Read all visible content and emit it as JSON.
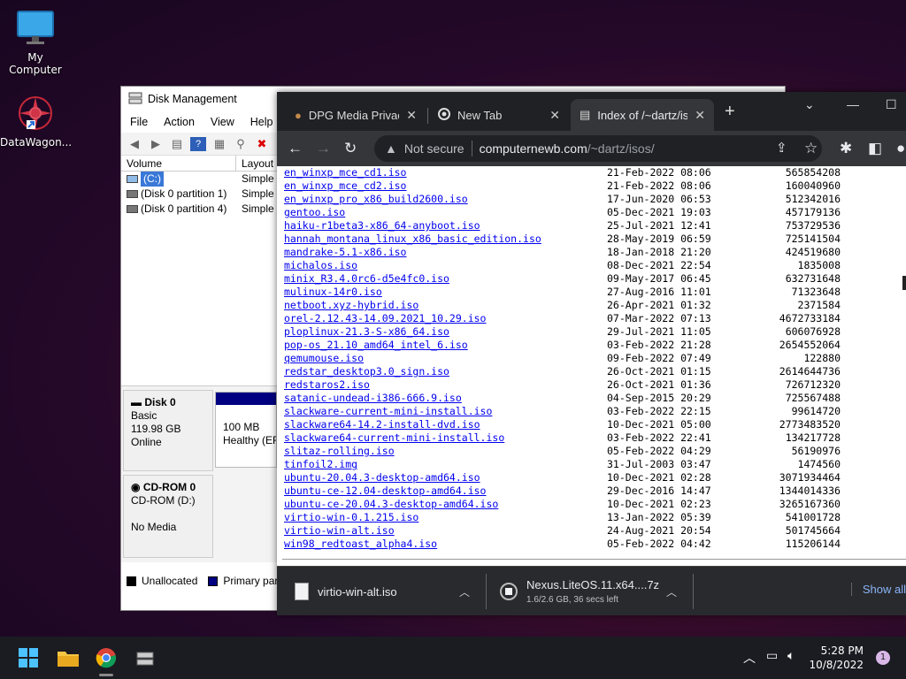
{
  "desktop": {
    "icons": [
      {
        "label": "My Computer"
      },
      {
        "label": "DataWagon..."
      }
    ]
  },
  "disk_management": {
    "title": "Disk Management",
    "menu": [
      "File",
      "Action",
      "View",
      "Help"
    ],
    "columns": [
      "Volume",
      "Layout"
    ],
    "volumes": [
      {
        "name": "(C:)",
        "layout": "Simple"
      },
      {
        "name": "(Disk 0 partition 1)",
        "layout": "Simple"
      },
      {
        "name": "(Disk 0 partition 4)",
        "layout": "Simple"
      }
    ],
    "disk0": {
      "name": "Disk 0",
      "type": "Basic",
      "size": "119.98 GB",
      "status": "Online"
    },
    "partition": {
      "size": "100 MB",
      "status": "Healthy (EF"
    },
    "cdrom": {
      "name": "CD-ROM 0",
      "type": "CD-ROM (D:)",
      "status": "No Media"
    },
    "legend": [
      {
        "label": "Unallocated",
        "color": "#000000"
      },
      {
        "label": "Primary parti",
        "color": "#000080"
      }
    ]
  },
  "browser": {
    "tabs": [
      {
        "title": "DPG Media Privacy"
      },
      {
        "title": "New Tab"
      },
      {
        "title": "Index of /~dartz/is"
      }
    ],
    "address": {
      "security": "Not secure",
      "host": "computernewb.com",
      "path": "/~dartz/isos/"
    },
    "files": [
      {
        "name": "en_winxp_mce_cd1.iso",
        "date": "21-Feb-2022 08:06",
        "size": "565854208"
      },
      {
        "name": "en_winxp_mce_cd2.iso",
        "date": "21-Feb-2022 08:06",
        "size": "160040960"
      },
      {
        "name": "en_winxp_pro_x86_build2600.iso",
        "date": "17-Jun-2020 06:53",
        "size": "512342016"
      },
      {
        "name": "gentoo.iso",
        "date": "05-Dec-2021 19:03",
        "size": "457179136"
      },
      {
        "name": "haiku-r1beta3-x86_64-anyboot.iso",
        "date": "25-Jul-2021 12:41",
        "size": "753729536"
      },
      {
        "name": "hannah_montana_linux_x86_basic_edition.iso",
        "date": "28-May-2019 06:59",
        "size": "725141504"
      },
      {
        "name": "mandrake-5.1-x86.iso",
        "date": "18-Jan-2018 21:20",
        "size": "424519680"
      },
      {
        "name": "michalos.iso",
        "date": "08-Dec-2021 22:54",
        "size": "1835008"
      },
      {
        "name": "minix_R3.4.0rc6-d5e4fc0.iso",
        "date": "09-May-2017 06:45",
        "size": "632731648"
      },
      {
        "name": "mulinux-14r0.iso",
        "date": "27-Aug-2016 11:01",
        "size": "71323648"
      },
      {
        "name": "netboot.xyz-hybrid.iso",
        "date": "26-Apr-2021 01:32",
        "size": "2371584"
      },
      {
        "name": "orel-2.12.43-14.09.2021_10.29.iso",
        "date": "07-Mar-2022 07:13",
        "size": "4672733184"
      },
      {
        "name": "ploplinux-21.3-S-x86_64.iso",
        "date": "29-Jul-2021 11:05",
        "size": "606076928"
      },
      {
        "name": "pop-os_21.10_amd64_intel_6.iso",
        "date": "03-Feb-2022 21:28",
        "size": "2654552064"
      },
      {
        "name": "qemumouse.iso",
        "date": "09-Feb-2022 07:49",
        "size": "122880"
      },
      {
        "name": "redstar_desktop3.0_sign.iso",
        "date": "26-Oct-2021 01:15",
        "size": "2614644736"
      },
      {
        "name": "redstaros2.iso",
        "date": "26-Oct-2021 01:36",
        "size": "726712320"
      },
      {
        "name": "satanic-undead-i386-666.9.iso",
        "date": "04-Sep-2015 20:29",
        "size": "725567488"
      },
      {
        "name": "slackware-current-mini-install.iso",
        "date": "03-Feb-2022 22:15",
        "size": "99614720"
      },
      {
        "name": "slackware64-14.2-install-dvd.iso",
        "date": "10-Dec-2021 05:00",
        "size": "2773483520"
      },
      {
        "name": "slackware64-current-mini-install.iso",
        "date": "03-Feb-2022 22:41",
        "size": "134217728"
      },
      {
        "name": "slitaz-rolling.iso",
        "date": "05-Feb-2022 04:29",
        "size": "56190976"
      },
      {
        "name": "tinfoil2.img",
        "date": "31-Jul-2003 03:47",
        "size": "1474560"
      },
      {
        "name": "ubuntu-20.04.3-desktop-amd64.iso",
        "date": "10-Dec-2021 02:28",
        "size": "3071934464"
      },
      {
        "name": "ubuntu-ce-12.04-desktop-amd64.iso",
        "date": "29-Dec-2016 14:47",
        "size": "1344014336"
      },
      {
        "name": "ubuntu-ce-20.04.3-desktop-amd64.iso",
        "date": "10-Dec-2021 02:23",
        "size": "3265167360"
      },
      {
        "name": "virtio-win-0.1.215.iso",
        "date": "13-Jan-2022 05:39",
        "size": "541001728"
      },
      {
        "name": "virtio-win-alt.iso",
        "date": "24-Aug-2021 20:54",
        "size": "501745664"
      },
      {
        "name": "win98_redtoast_alpha4.iso",
        "date": "05-Feb-2022 04:42",
        "size": "115206144"
      }
    ],
    "downloads": [
      {
        "name": "virtio-win-alt.iso",
        "status": ""
      },
      {
        "name": "Nexus.LiteOS.11.x64....7z",
        "status": "1.6/2.6 GB, 36 secs left"
      }
    ],
    "show_all": "Show all"
  },
  "taskbar": {
    "time": "5:28 PM",
    "date": "10/8/2022",
    "notifications": "1"
  }
}
